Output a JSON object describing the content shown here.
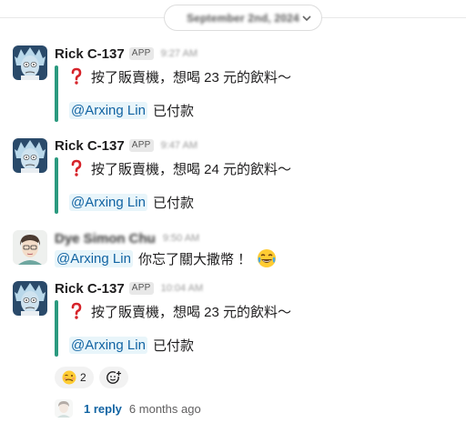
{
  "date_divider": {
    "label": "September 2nd, 2024"
  },
  "messages": [
    {
      "sender": "Rick C-137",
      "badge": "APP",
      "time": "9:27 AM",
      "text": "按了販賣機，想喝 23 元的飲料～",
      "mention": "@Arxing Lin",
      "status": "已付款"
    },
    {
      "sender": "Rick C-137",
      "badge": "APP",
      "time": "9:47 AM",
      "text": "按了販賣機，想喝 24 元的飲料～",
      "mention": "@Arxing Lin",
      "status": "已付款"
    },
    {
      "sender": "Dye Simon Chu",
      "time": "9:50 AM",
      "mention": "@Arxing Lin",
      "text": "你忘了關大撒幣 ！",
      "emoji": "joy-emoji"
    },
    {
      "sender": "Rick C-137",
      "badge": "APP",
      "time": "10:04 AM",
      "text": "按了販賣機，想喝 23 元的飲料～",
      "mention": "@Arxing Lin",
      "status": "已付款"
    }
  ],
  "reactions": [
    {
      "emoji": "woozy-face-emoji",
      "count": "2"
    }
  ],
  "thread": {
    "reply_label": "1 reply",
    "ago": "6 months ago"
  },
  "colors": {
    "attachment_bar": "#2b9a7f",
    "mention_bg": "#e8f5fa",
    "mention_text": "#1264a3",
    "link": "#1264a3"
  }
}
